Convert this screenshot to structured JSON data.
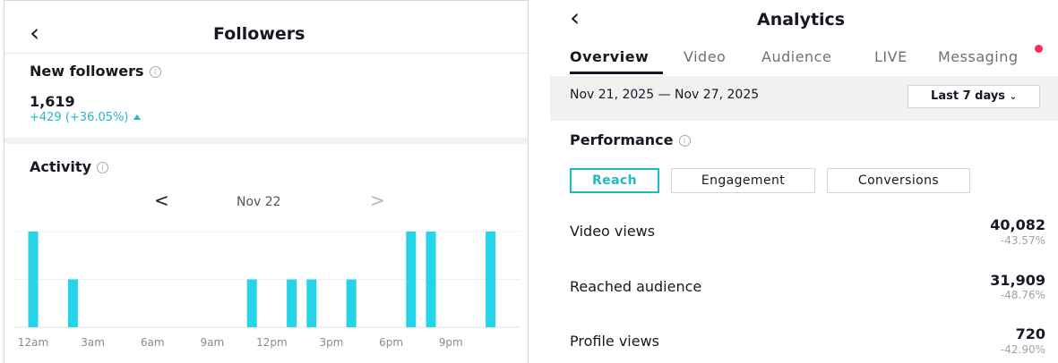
{
  "followers": {
    "back_icon": "chevron-left-icon",
    "title": "Followers",
    "new_followers": {
      "label": "New followers",
      "count": "1,619",
      "change": "+429 (+36.05%)"
    },
    "activity": {
      "label": "Activity",
      "date": "Nov 22",
      "prev": "<",
      "next": ">"
    },
    "chart_data": {
      "type": "bar",
      "categories": [
        "12am",
        "1am",
        "2am",
        "3am",
        "4am",
        "5am",
        "6am",
        "7am",
        "8am",
        "9am",
        "10am",
        "11am",
        "12pm",
        "1pm",
        "2pm",
        "3pm",
        "4pm",
        "5pm",
        "6pm",
        "7pm",
        "8pm",
        "9pm",
        "10pm",
        "11pm"
      ],
      "values": [
        2,
        0,
        1,
        0,
        0,
        0,
        0,
        0,
        0,
        0,
        0,
        1,
        0,
        1,
        1,
        0,
        1,
        0,
        0,
        2,
        2,
        0,
        0,
        2
      ],
      "tick_labels": [
        "12am",
        "3am",
        "6am",
        "9am",
        "12pm",
        "3pm",
        "6pm",
        "9pm"
      ],
      "ylim": [
        0,
        2
      ],
      "bar_color": "#25d4e8",
      "grid": true
    }
  },
  "analytics": {
    "back_icon": "chevron-left-icon",
    "title": "Analytics",
    "tabs": [
      "Overview",
      "Video",
      "Audience",
      "LIVE",
      "Messaging"
    ],
    "active_tab": "Overview",
    "notification_color": "#fe2c55",
    "date_range": "Nov 21, 2025 — Nov 27, 2025",
    "range_select": "Last 7 days",
    "performance_label": "Performance",
    "subtabs": [
      "Reach",
      "Engagement",
      "Conversions"
    ],
    "active_subtab": "Reach",
    "metrics": [
      {
        "label": "Video views",
        "value": "40,082",
        "change": "-43.57%"
      },
      {
        "label": "Reached audience",
        "value": "31,909",
        "change": "-48.76%"
      },
      {
        "label": "Profile views",
        "value": "720",
        "change": "-42.90%"
      }
    ]
  }
}
